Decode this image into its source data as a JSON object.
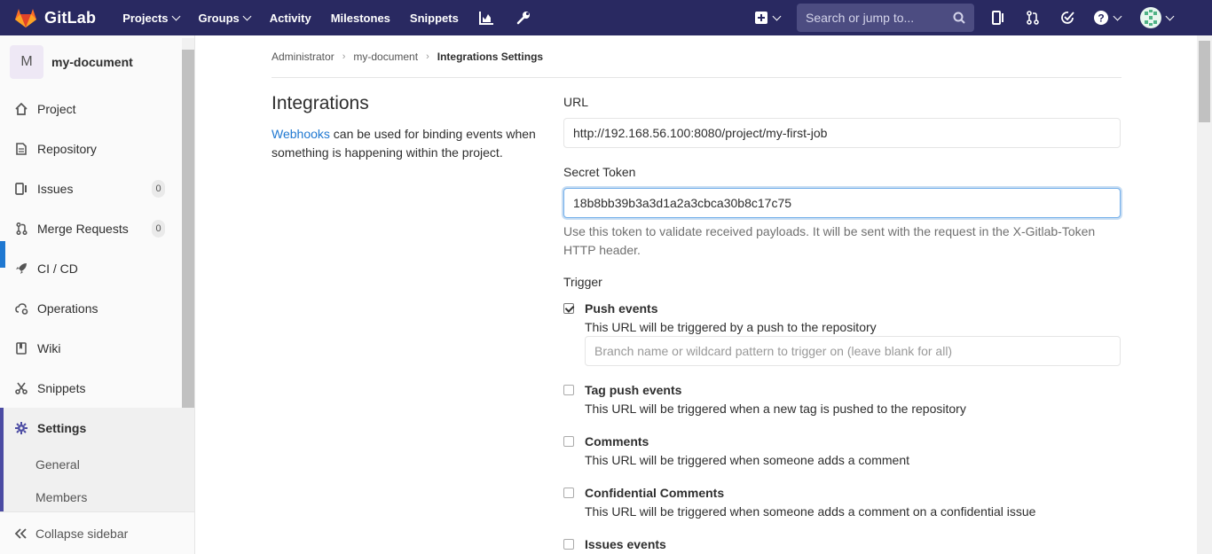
{
  "navbar": {
    "brand": "GitLab",
    "links": [
      {
        "label": "Projects",
        "dropdown": true
      },
      {
        "label": "Groups",
        "dropdown": true
      },
      {
        "label": "Activity",
        "dropdown": false
      },
      {
        "label": "Milestones",
        "dropdown": false
      },
      {
        "label": "Snippets",
        "dropdown": false
      }
    ],
    "search_placeholder": "Search or jump to...",
    "colors": {
      "background": "#292961",
      "search_bg": "#4c4c81"
    }
  },
  "sidebar": {
    "project_initial": "M",
    "project_name": "my-document",
    "items": [
      {
        "label": "Project",
        "icon": "home-icon"
      },
      {
        "label": "Repository",
        "icon": "doc-icon"
      },
      {
        "label": "Issues",
        "icon": "issues-icon",
        "badge": "0"
      },
      {
        "label": "Merge Requests",
        "icon": "merge-request-icon",
        "badge": "0"
      },
      {
        "label": "CI / CD",
        "icon": "rocket-icon"
      },
      {
        "label": "Operations",
        "icon": "cloud-gear-icon"
      },
      {
        "label": "Wiki",
        "icon": "book-icon"
      },
      {
        "label": "Snippets",
        "icon": "scissors-icon"
      },
      {
        "label": "Settings",
        "icon": "gear-icon"
      }
    ],
    "settings_sub": [
      "General",
      "Members"
    ],
    "collapse_label": "Collapse sidebar"
  },
  "breadcrumb": [
    "Administrator",
    "my-document",
    "Integrations Settings"
  ],
  "intro": {
    "title": "Integrations",
    "link": "Webhooks",
    "desc": " can be used for binding events when something is happening within the project."
  },
  "form": {
    "url_label": "URL",
    "url_value": "http://192.168.56.100:8080/project/my-first-job",
    "token_label": "Secret Token",
    "token_value": "18b8bb39b3a3d1a2a3cbca30b8c17c75",
    "token_help": "Use this token to validate received payloads. It will be sent with the request in the X-Gitlab-Token HTTP header.",
    "trigger_label": "Trigger",
    "branch_placeholder": "Branch name or wildcard pattern to trigger on (leave blank for all)",
    "events": [
      {
        "title": "Push events",
        "desc": "This URL will be triggered by a push to the repository",
        "checked": true
      },
      {
        "title": "Tag push events",
        "desc": "This URL will be triggered when a new tag is pushed to the repository",
        "checked": false
      },
      {
        "title": "Comments",
        "desc": "This URL will be triggered when someone adds a comment",
        "checked": false
      },
      {
        "title": "Confidential Comments",
        "desc": "This URL will be triggered when someone adds a comment on a confidential issue",
        "checked": false
      },
      {
        "title": "Issues events",
        "desc": "",
        "checked": false
      }
    ]
  }
}
